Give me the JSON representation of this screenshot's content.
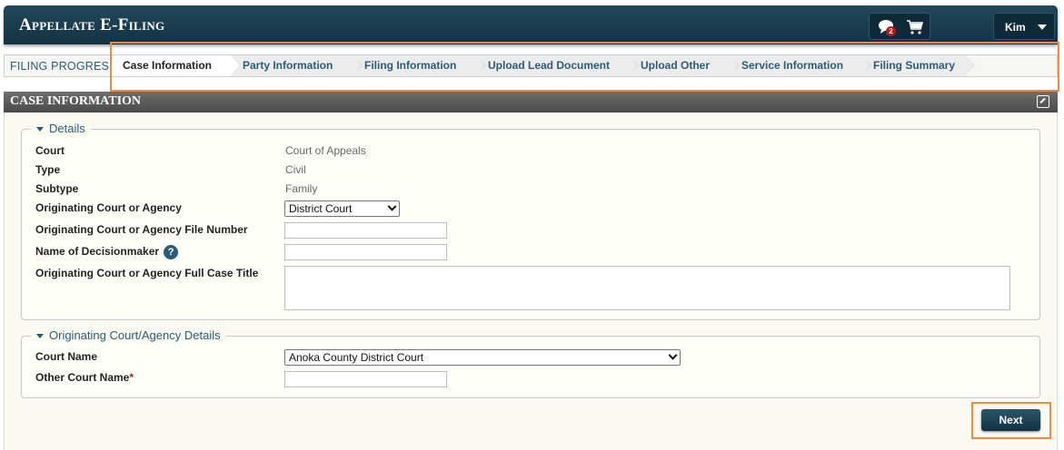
{
  "app": {
    "title": "Appellate E-Filing"
  },
  "header": {
    "chat_badge_count": "2",
    "user_name": "Kim"
  },
  "progress": {
    "label": "FILING PROGRESS",
    "steps": [
      {
        "label": "Case Information",
        "active": true
      },
      {
        "label": "Party Information",
        "active": false
      },
      {
        "label": "Filing Information",
        "active": false
      },
      {
        "label": "Upload Lead Document",
        "active": false
      },
      {
        "label": "Upload Other",
        "active": false
      },
      {
        "label": "Service Information",
        "active": false
      },
      {
        "label": "Filing Summary",
        "active": false
      }
    ]
  },
  "section": {
    "title": "CASE INFORMATION"
  },
  "details": {
    "legend": "Details",
    "court_label": "Court",
    "court_value": "Court of Appeals",
    "type_label": "Type",
    "type_value": "Civil",
    "subtype_label": "Subtype",
    "subtype_value": "Family",
    "orig_court_label": "Originating Court or Agency",
    "orig_court_value": "District Court",
    "file_number_label": "Originating Court or Agency File Number",
    "file_number_value": "",
    "decisionmaker_label": "Name of Decisionmaker",
    "decisionmaker_value": "",
    "help_symbol": "?",
    "full_case_title_label": "Originating Court or Agency Full Case Title",
    "full_case_title_value": ""
  },
  "agency": {
    "legend": "Originating Court/Agency Details",
    "court_name_label": "Court Name",
    "court_name_value": "Anoka County District Court",
    "other_court_label": "Other Court Name",
    "required_marker": "*",
    "other_court_value": ""
  },
  "actions": {
    "next_label": "Next"
  },
  "colors": {
    "accent": "#2b5c77",
    "header": "#1b3d4f",
    "highlight": "#f08a3c",
    "required": "#c0161a"
  }
}
